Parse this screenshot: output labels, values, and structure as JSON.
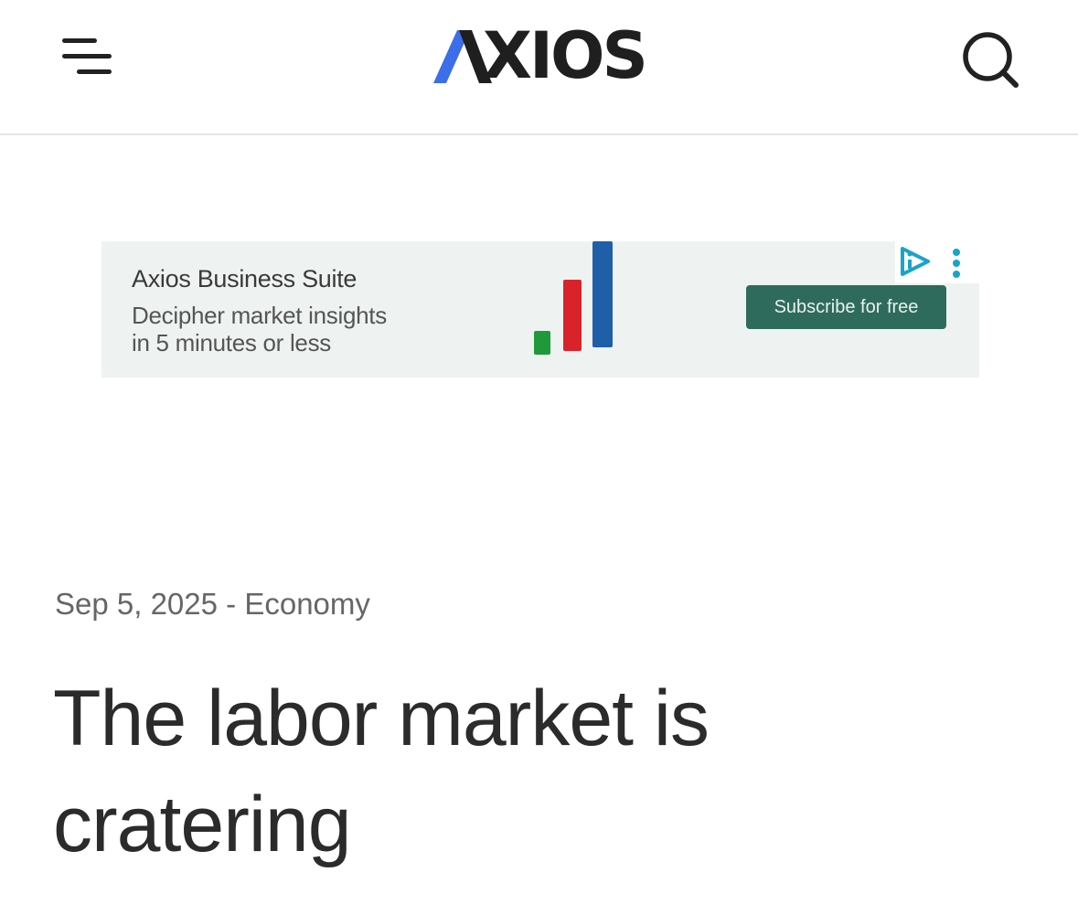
{
  "header": {
    "logo_text": "AXIOS",
    "logo_rest": "XIOS",
    "menu_icon": "hamburger-menu-icon",
    "search_icon": "search-icon"
  },
  "ad": {
    "brand": "Axios Business Suite",
    "line1": "Decipher market insights",
    "line2": "in 5 minutes or less",
    "cta_label": "Subscribe for free",
    "adchoices_icon": "adchoices-icon",
    "more_icon": "more-vertical-icon",
    "chart_colors": [
      "#1f9a3a",
      "#d8232a",
      "#1f5fa8"
    ]
  },
  "article": {
    "date": "Sep 5, 2025",
    "separator": " - ",
    "section": "Economy",
    "title": "The labor market is cratering"
  },
  "colors": {
    "logo_blue": "#3b6ee8",
    "logo_dark": "#1f1f1f",
    "cta_green": "#2f6b5c",
    "adchoices": "#1aa3c8"
  }
}
